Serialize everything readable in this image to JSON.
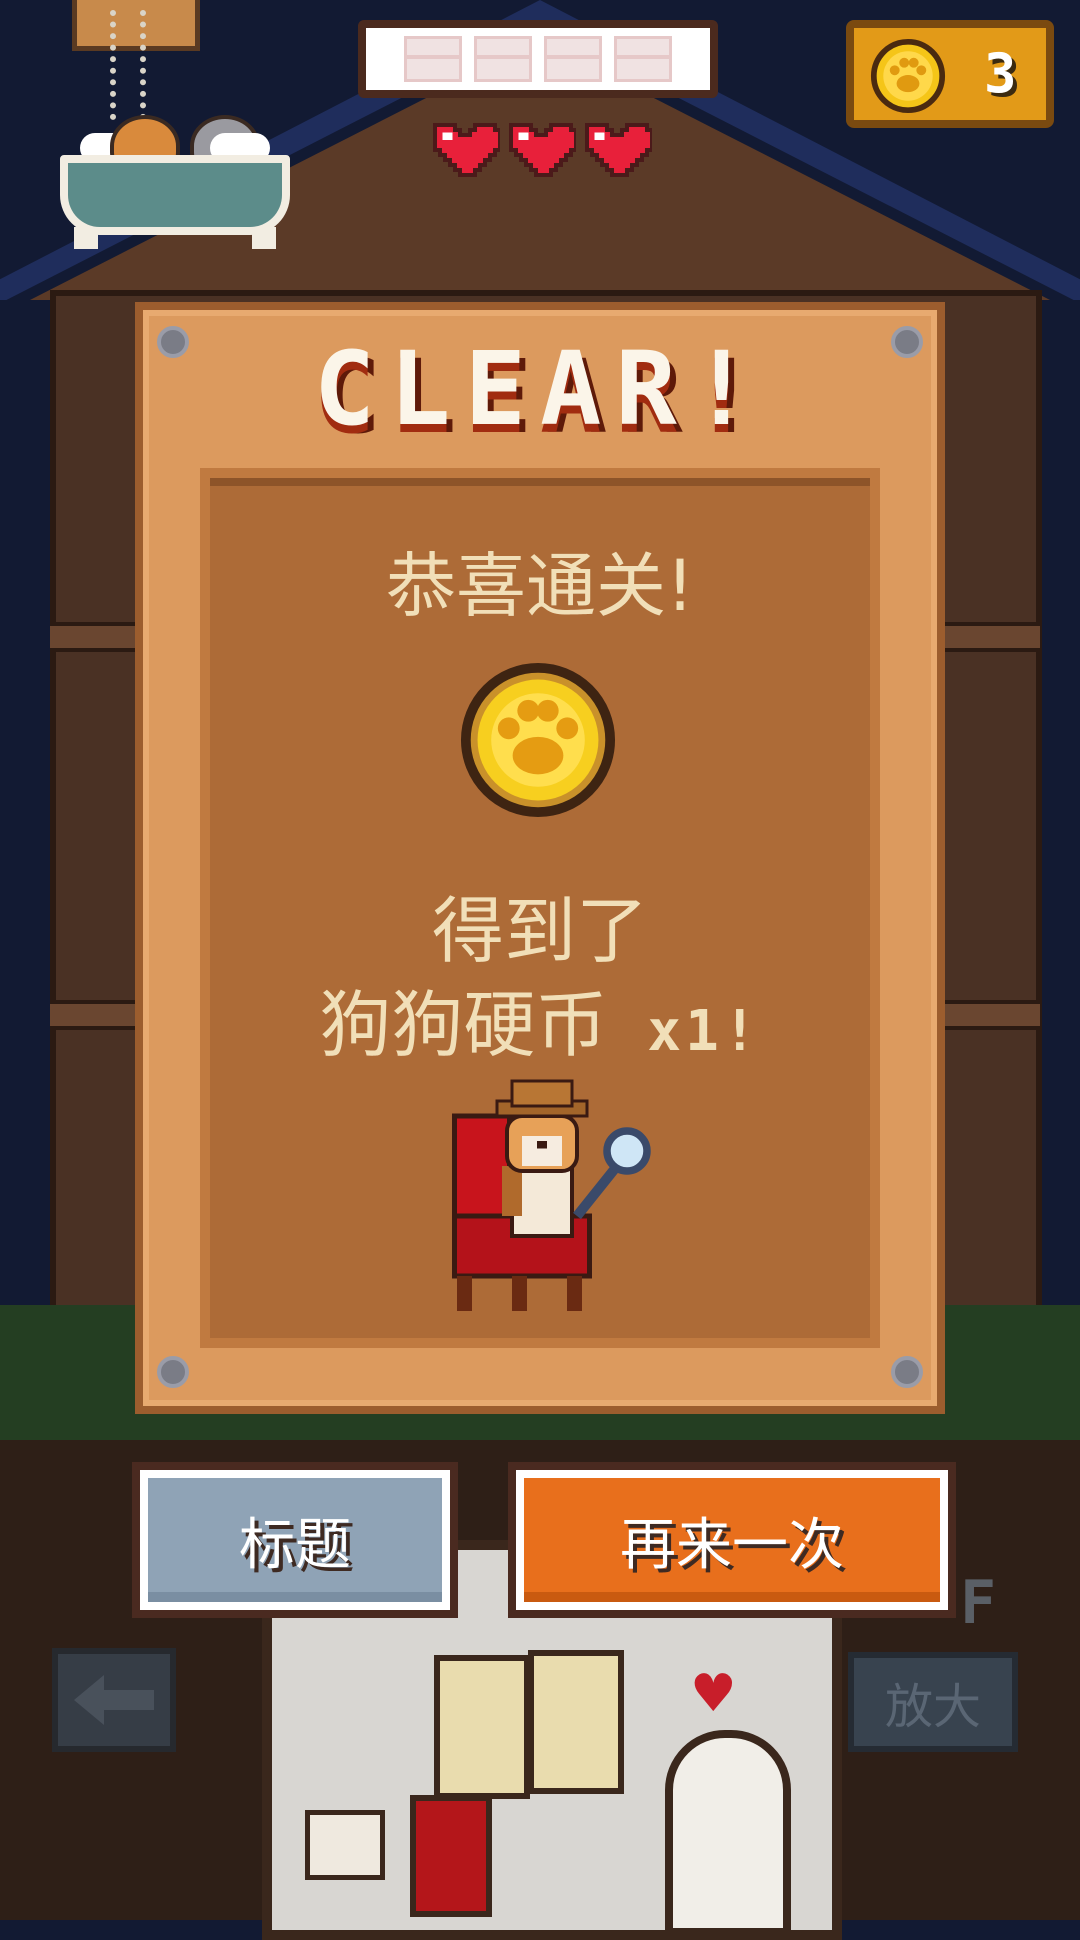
{
  "hud": {
    "chest_slots": 4,
    "lives": 3,
    "coin_count": "3"
  },
  "result": {
    "title": "CLEAR!",
    "congrats": "恭喜通关!",
    "got_label": "得到了",
    "reward_name": "狗狗硬币",
    "reward_qty": "x1!"
  },
  "buttons": {
    "title_label": "标题",
    "retry_label": "再来一次",
    "zoom_label": "放大"
  },
  "floor_indicator": "F",
  "colors": {
    "retry_button": "#e86f1c",
    "title_button": "#8fa3b6",
    "panel_wood": "#dc9a5e",
    "heart": "#e8203a",
    "coin": "#f5c518"
  },
  "icons": {
    "coin": "paw-coin-icon",
    "back": "arrow-left-icon",
    "chest": "treasure-chest-icon",
    "life": "heart-icon"
  }
}
